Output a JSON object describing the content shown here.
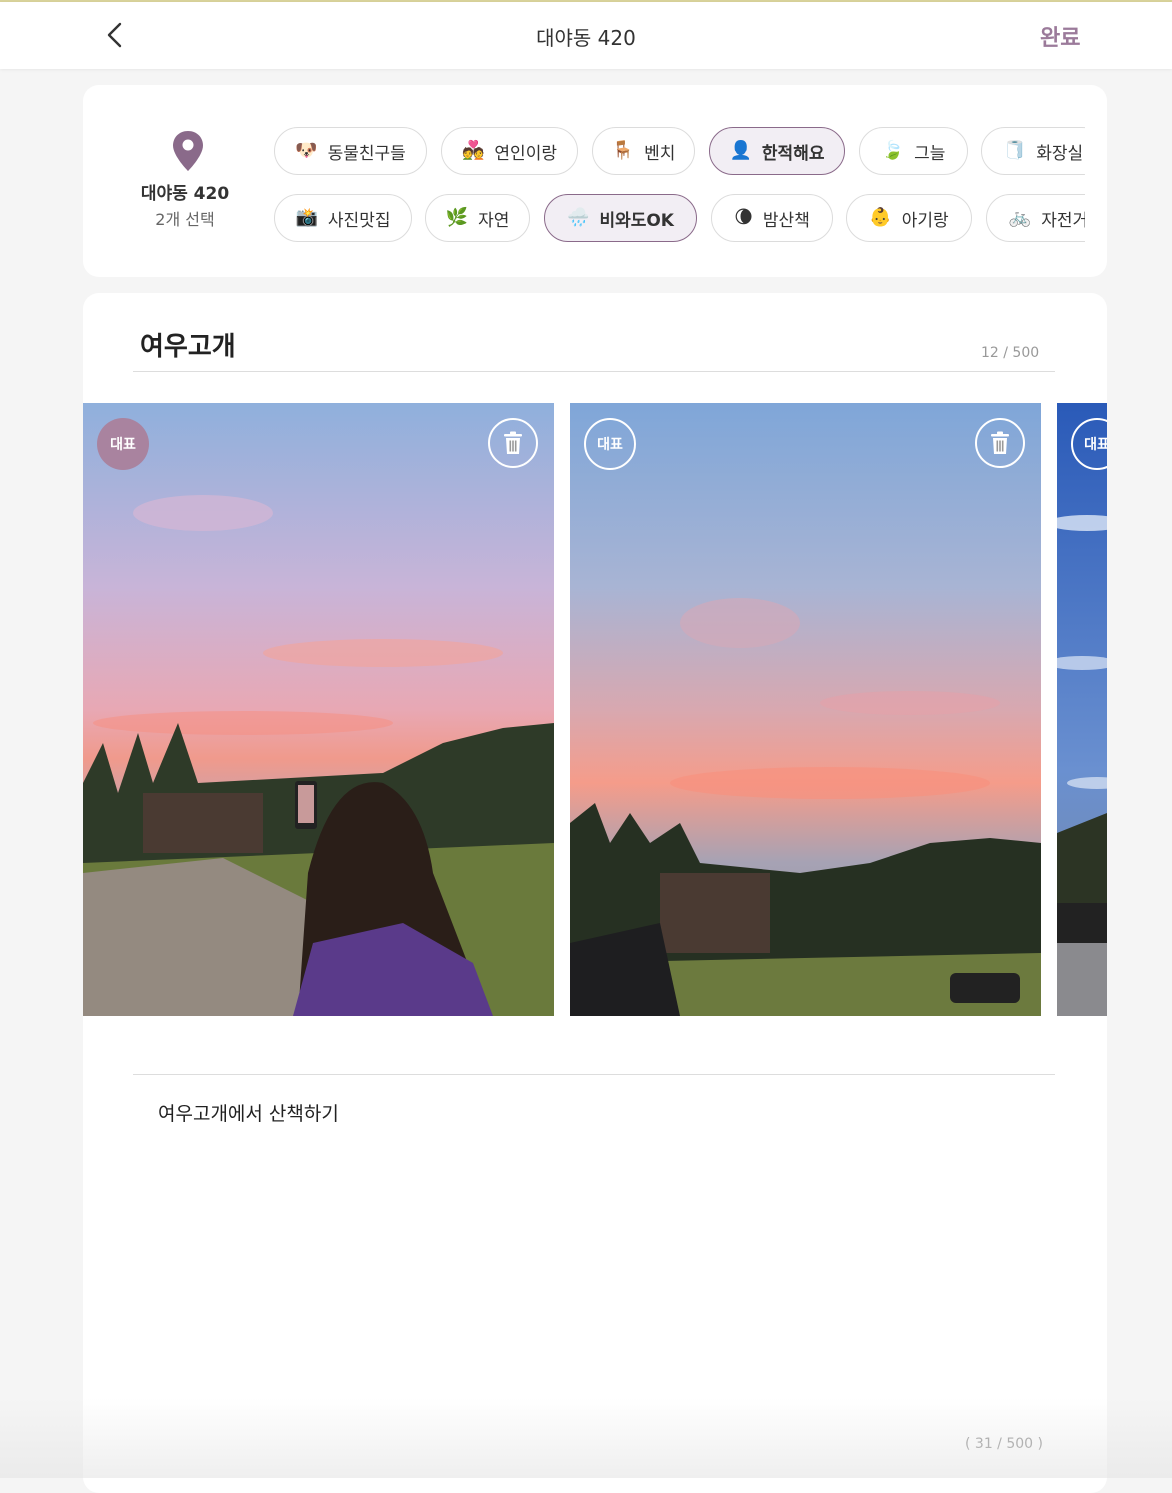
{
  "header": {
    "title": "대야동 420",
    "done_label": "완료"
  },
  "location": {
    "name": "대야동 420",
    "selected_count": "2개 선택"
  },
  "tags_row1": [
    {
      "icon": "🐶",
      "label": "동물친구들",
      "selected": false
    },
    {
      "icon": "💑",
      "label": "연인이랑",
      "selected": false
    },
    {
      "icon": "🪑",
      "label": "벤치",
      "selected": false
    },
    {
      "icon": "👤",
      "label": "한적해요",
      "selected": true
    },
    {
      "icon": "🍃",
      "label": "그늘",
      "selected": false
    },
    {
      "icon": "🧻",
      "label": "화장실",
      "selected": false
    }
  ],
  "tags_row2": [
    {
      "icon": "📸",
      "label": "사진맛집",
      "selected": false
    },
    {
      "icon": "🌿",
      "label": "자연",
      "selected": false
    },
    {
      "icon": "🌧️",
      "label": "비와도OK",
      "selected": true
    },
    {
      "icon": "🌘",
      "label": "밤산책",
      "selected": false
    },
    {
      "icon": "👶",
      "label": "아기랑",
      "selected": false
    },
    {
      "icon": "🚲",
      "label": "자전거",
      "selected": false
    }
  ],
  "post": {
    "title": "여우고개",
    "title_count": "12 / 500",
    "body": "여우고개에서 산책하기",
    "body_count": "( 31 / 500 )"
  },
  "photos": [
    {
      "badge": "대표",
      "representative": true
    },
    {
      "badge": "대표",
      "representative": false
    },
    {
      "badge": "대표",
      "representative": false
    }
  ],
  "colors": {
    "accent": "#9b7a9a",
    "selected_chip_bg": "#f2eef4",
    "badge_rep": "#a9839f"
  }
}
